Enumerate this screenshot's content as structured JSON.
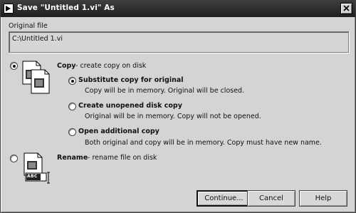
{
  "window": {
    "title": "Save \"Untitled 1.vi\" As"
  },
  "original": {
    "label": "Original file",
    "path": "C:\\Untitled 1.vi"
  },
  "options": {
    "copy": {
      "label": "Copy",
      "desc": " - create copy on disk",
      "selected": true,
      "sub": [
        {
          "label": "Substitute copy for original",
          "desc": "Copy will be in memory. Original will be closed.",
          "selected": true
        },
        {
          "label": "Create unopened disk copy",
          "desc": "Original will be in memory. Copy will not be opened.",
          "selected": false
        },
        {
          "label": "Open additional copy",
          "desc": "Both original and copy will be in memory. Copy must have new name.",
          "selected": false
        }
      ]
    },
    "rename": {
      "label": "Rename",
      "desc": " - rename file on disk",
      "selected": false,
      "icon_badge": "ABC"
    }
  },
  "buttons": {
    "continue": "Continue...",
    "cancel": "Cancel",
    "help": "Help"
  },
  "icons": {
    "app": "labview-vi-icon",
    "close": "close-icon",
    "copy": "copy-files-icon",
    "rename": "rename-file-icon"
  }
}
